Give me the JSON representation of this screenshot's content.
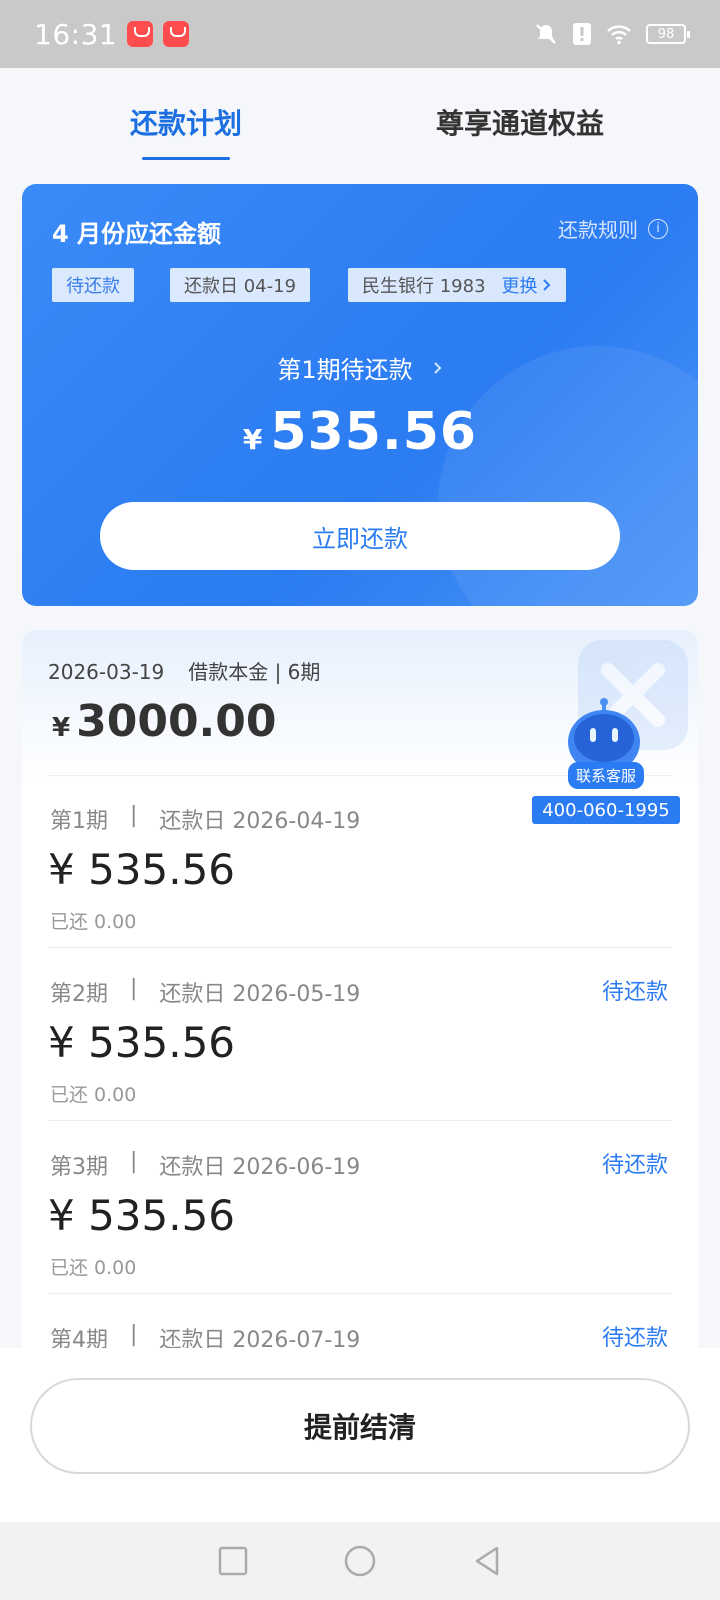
{
  "status_bar": {
    "time": "16:31",
    "battery": "98",
    "icons": [
      "shopping-bag-icon",
      "shopping-bag-icon",
      "mute-icon",
      "alert-icon",
      "wifi-icon",
      "battery-icon"
    ]
  },
  "tabs": [
    {
      "label": "还款计划",
      "active": true
    },
    {
      "label": "尊享通道权益",
      "active": false
    }
  ],
  "summary_card": {
    "title": "4 月份应还金额",
    "rules_label": "还款规则",
    "status_chip": "待还款",
    "due_chip": "还款日 04-19",
    "bank_chip": "民生银行 1983",
    "change_label": "更换",
    "period_label": "第1期待还款",
    "currency": "¥",
    "amount": "535.56",
    "pay_button": "立即还款"
  },
  "loan": {
    "date": "2026-03-19",
    "desc": "借款本金 | 6期",
    "currency": "¥",
    "amount": "3000.00"
  },
  "service": {
    "label": "联系客服",
    "phone": "400-060-1995"
  },
  "installments": [
    {
      "period": "第1期",
      "due": "还款日 2026-04-19",
      "status": "",
      "amount": "¥ 535.56",
      "paid": "已还 0.00"
    },
    {
      "period": "第2期",
      "due": "还款日 2026-05-19",
      "status": "待还款",
      "amount": "¥ 535.56",
      "paid": "已还 0.00"
    },
    {
      "period": "第3期",
      "due": "还款日 2026-06-19",
      "status": "待还款",
      "amount": "¥ 535.56",
      "paid": "已还 0.00"
    },
    {
      "period": "第4期",
      "due": "还款日 2026-07-19",
      "status": "待还款",
      "amount": "",
      "paid": ""
    }
  ],
  "sep": "|",
  "settle_button": "提前结清",
  "colors": {
    "primary": "#2b7bf2",
    "text": "#222222",
    "muted": "#888888"
  }
}
